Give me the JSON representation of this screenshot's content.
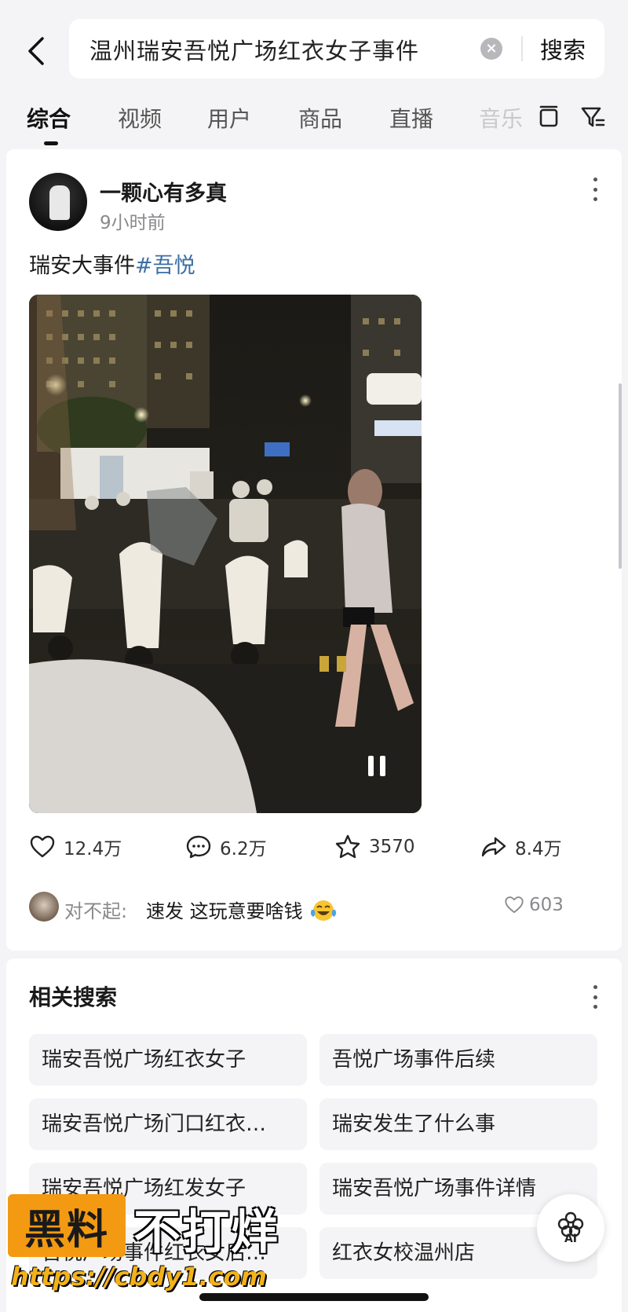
{
  "search": {
    "query": "温州瑞安吾悦广场红衣女子事件",
    "submit_label": "搜索"
  },
  "tabs": [
    "综合",
    "视频",
    "用户",
    "商品",
    "直播",
    "音乐"
  ],
  "post": {
    "username": "一颗心有多真",
    "time": "9小时前",
    "caption_text": "瑞安大事件",
    "hashtag": "#吾悦",
    "likes": "12.4万",
    "comments": "6.2万",
    "favorites": "3570",
    "shares": "8.4万",
    "top_comment": {
      "user": "对不起:",
      "text": "速发 这玩意要啥钱",
      "likes": "603"
    }
  },
  "related": {
    "title": "相关搜索",
    "items": [
      "瑞安吾悦广场红衣女子",
      "吾悦广场事件后续",
      "瑞安吾悦广场门口红衣…",
      "瑞安发生了什么事",
      "瑞安吾悦广场红发女子",
      "瑞安吾悦广场事件详情",
      "吾悦广场事件红衣女后…",
      "红衣女校温州店"
    ]
  },
  "ai_button_label": "AI",
  "watermark": {
    "badge": "黑料",
    "text": "不打烊",
    "url": "https://cbdy1.com"
  },
  "colors": {
    "page_bg": "#f4f4f6",
    "hashtag": "#3a6ea5",
    "watermark_orange": "#f39a12"
  }
}
